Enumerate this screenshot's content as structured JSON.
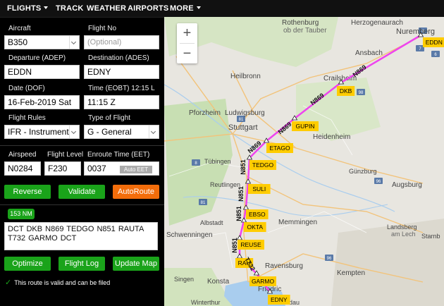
{
  "nav": {
    "flights": "FLIGHTS",
    "track": "TRACK",
    "weather": "WEATHER",
    "airports": "AIRPORTS",
    "more": "MORE"
  },
  "form": {
    "aircraft": {
      "label": "Aircraft",
      "value": "B350"
    },
    "flight_no": {
      "label": "Flight No",
      "placeholder": "(Optional)"
    },
    "departure": {
      "label": "Departure (ADEP)",
      "value": "EDDN"
    },
    "destination": {
      "label": "Destination (ADES)",
      "value": "EDNY"
    },
    "date": {
      "label": "Date (DOF)",
      "value": "16-Feb-2019 Sat"
    },
    "time": {
      "label": "Time (EOBT) 12:15 L",
      "value": "11:15 Z"
    },
    "flight_rules": {
      "label": "Flight Rules",
      "value": "IFR - Instrument"
    },
    "flight_type": {
      "label": "Type of Flight",
      "value": "G - General"
    },
    "airspeed": {
      "label": "Airspeed",
      "value": "N0284"
    },
    "flight_level": {
      "label": "Flight Level",
      "value": "F230"
    },
    "eet": {
      "label": "Enroute Time (EET)",
      "value": "0037",
      "auto_label": "Auto EET"
    }
  },
  "buttons": {
    "reverse": "Reverse",
    "validate": "Validate",
    "autoroute": "AutoRoute",
    "optimize": "Optimize",
    "flight_log": "Flight Log",
    "update_map": "Update Map"
  },
  "route": {
    "distance": "153 NM",
    "text": "DCT DKB N869 TEDGO N851 RAUTA T732 GARMO DCT",
    "status": "This route is valid and can be filed"
  },
  "colors": {
    "accent_green": "#1aa31a",
    "accent_orange": "#f36d0b",
    "route_line": "#ee44ee",
    "waypoint_fill": "#ffcc00"
  },
  "map": {
    "zoom_in": "+",
    "zoom_out": "−",
    "cities": [
      {
        "name": "Rothenburg",
        "sub": false
      },
      {
        "name": "ob der Tauber",
        "sub": true
      },
      {
        "name": "Herzogenaurach",
        "sub": false
      },
      {
        "name": "Nuremberg",
        "sub": false
      },
      {
        "name": "Ansbach",
        "sub": false
      },
      {
        "name": "Heilbronn",
        "sub": false
      },
      {
        "name": "Crailsheim",
        "sub": false
      },
      {
        "name": "Pforzheim",
        "sub": false
      },
      {
        "name": "Ludwigsburg",
        "sub": false
      },
      {
        "name": "Stuttgart",
        "sub": false
      },
      {
        "name": "Heidenheim",
        "sub": false
      },
      {
        "name": "Günzburg",
        "sub": false
      },
      {
        "name": "Augsburg",
        "sub": false
      },
      {
        "name": "Tübingen",
        "sub": false
      },
      {
        "name": "Reutlingen",
        "sub": false
      },
      {
        "name": "Albstadt",
        "sub": false
      },
      {
        "name": "Memmingen",
        "sub": false
      },
      {
        "name": "Landsberg",
        "sub": false
      },
      {
        "name": "am Lech",
        "sub": true
      },
      {
        "name": "Schwenningen",
        "sub": false
      },
      {
        "name": "Ravensburg",
        "sub": false
      },
      {
        "name": "Kempten",
        "sub": false
      },
      {
        "name": "Singen",
        "sub": false
      },
      {
        "name": "Konsta",
        "sub": false
      },
      {
        "name": "Friedric",
        "sub": false
      },
      {
        "name": "Lindau",
        "sub": false
      },
      {
        "name": "Winterthur",
        "sub": false
      },
      {
        "name": "Starnb",
        "sub": false
      }
    ],
    "waypoints": [
      "EDDN",
      "DKB",
      "GUPIN",
      "ETAGO",
      "TEDGO",
      "SULI",
      "EBSO",
      "OKTA",
      "REUSE",
      "RAU",
      "GARMO",
      "EDNY"
    ],
    "airway_labels": [
      "N869",
      "N869",
      "N869",
      "N869",
      "N851",
      "N851",
      "N851",
      "N851",
      "T732"
    ],
    "road_numbers": [
      "6",
      "7",
      "6",
      "81",
      "8",
      "98",
      "81",
      "96",
      "96",
      "7"
    ]
  }
}
